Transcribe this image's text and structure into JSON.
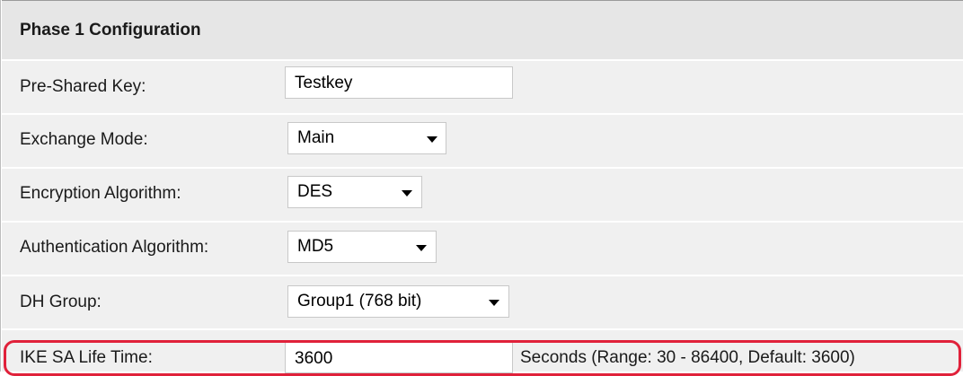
{
  "section": {
    "title": "Phase 1 Configuration"
  },
  "fields": {
    "pre_shared_key": {
      "label": "Pre-Shared Key:",
      "value": "Testkey"
    },
    "exchange_mode": {
      "label": "Exchange Mode:",
      "value": "Main"
    },
    "encryption_algorithm": {
      "label": "Encryption Algorithm:",
      "value": "DES"
    },
    "authentication_algorithm": {
      "label": "Authentication Algorithm:",
      "value": "MD5"
    },
    "dh_group": {
      "label": "DH Group:",
      "value": "Group1 (768 bit)"
    },
    "ike_sa_life_time": {
      "label": "IKE SA Life Time:",
      "value": "3600",
      "hint": "Seconds  (Range: 30 - 86400, Default: 3600)"
    }
  },
  "colors": {
    "highlight": "#e0213a",
    "row_background": "#f0f0f0",
    "header_background": "#e6e6e6"
  }
}
